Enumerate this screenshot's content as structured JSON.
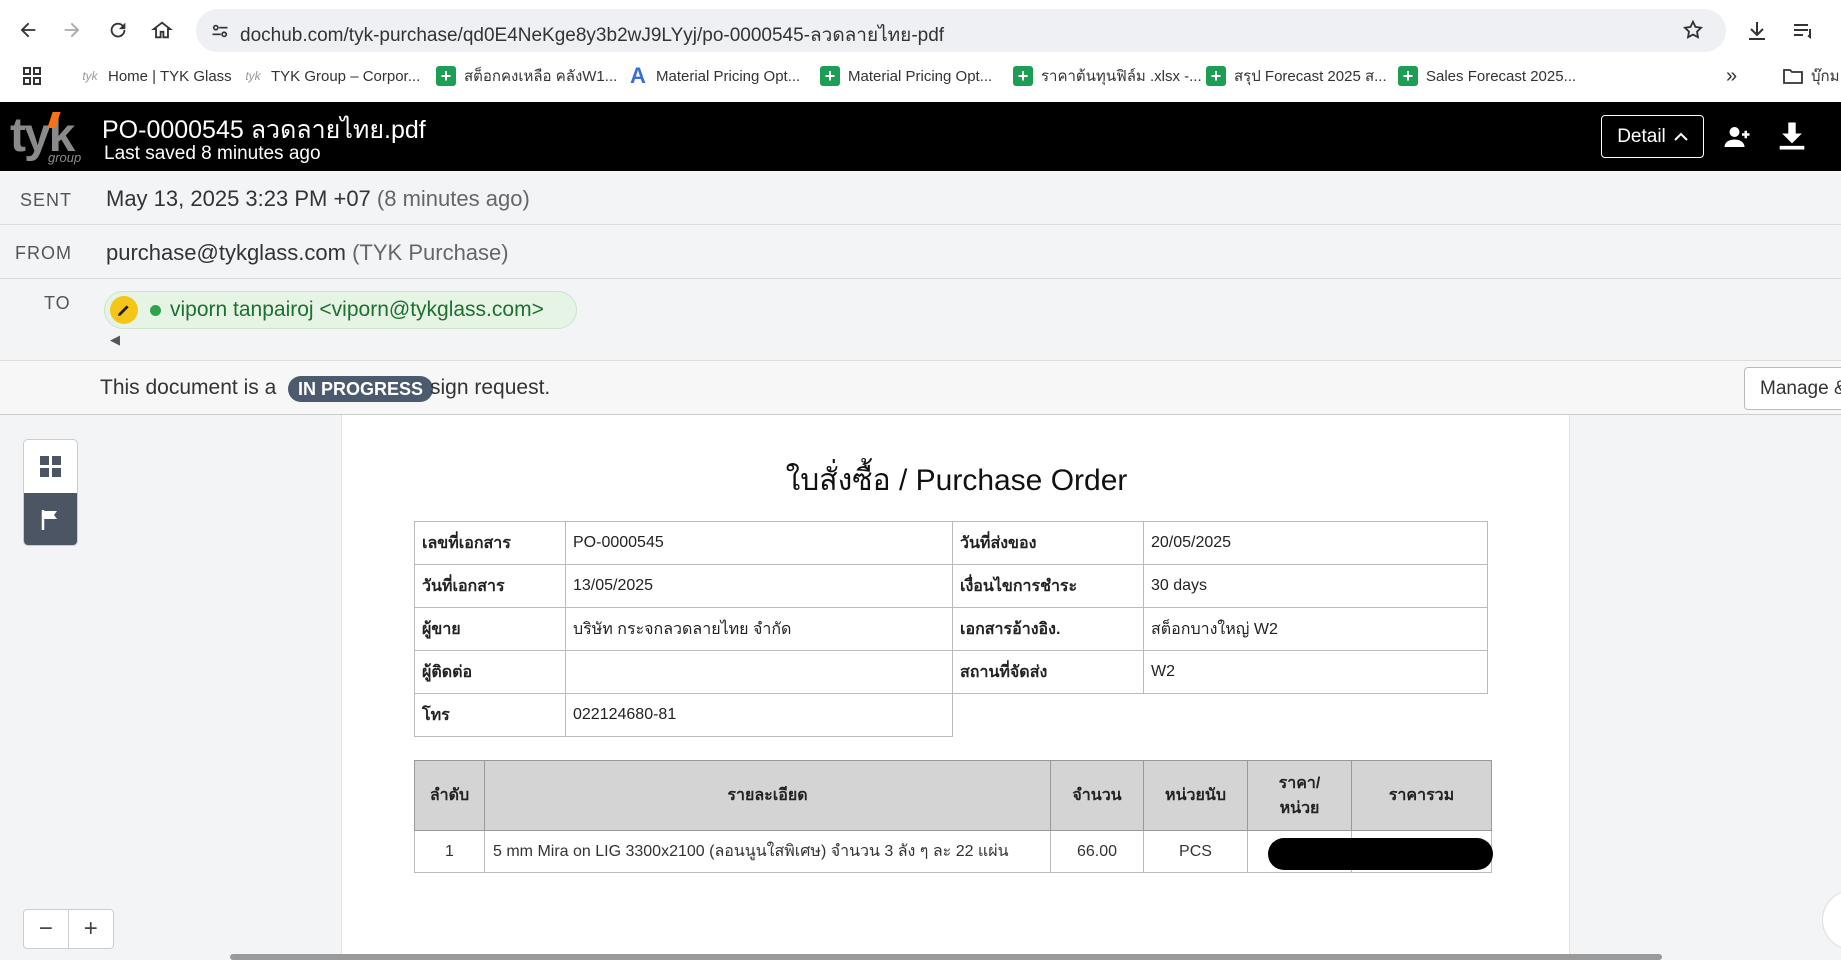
{
  "browser": {
    "url": "dochub.com/tyk-purchase/qd0E4NeKge8y3b2wJ9LYyj/po-0000545-ลวดลายไทย-pdf",
    "bookmarks": [
      {
        "label": "Home | TYK Glass",
        "icon": "tyk-icon"
      },
      {
        "label": "TYK Group – Corpor...",
        "icon": "tyk-icon"
      },
      {
        "label": "สต็อกคงเหลือ คลังW1...",
        "icon": "sheets-icon"
      },
      {
        "label": "Material Pricing Opt...",
        "icon": "font-a-icon"
      },
      {
        "label": "Material Pricing Opt...",
        "icon": "sheets-icon"
      },
      {
        "label": "ราคาต้นทุนฟิล์ม .xlsx -...",
        "icon": "sheets-icon"
      },
      {
        "label": "สรุป Forecast 2025 ส...",
        "icon": "sheets-icon"
      },
      {
        "label": "Sales Forecast 2025...",
        "icon": "sheets-icon"
      }
    ],
    "bookmark_folder": "บุ๊กม",
    "more": "»"
  },
  "header": {
    "logo_main": "tyk",
    "logo_sub": "group",
    "title": "PO-0000545 ลวดลายไทย.pdf",
    "saved": "Last saved 8 minutes ago",
    "detail_label": "Detail",
    "accent": "#f97316"
  },
  "meta": {
    "sent_label": "SENT",
    "sent_value": "May 13, 2025 3:23 PM +07",
    "sent_ago": "(8 minutes ago)",
    "from_label": "FROM",
    "from_email": "purchase@tykglass.com",
    "from_name": "(TYK Purchase)",
    "to_label": "TO",
    "recipient": "viporn tanpairoj <viporn@tykglass.com>"
  },
  "status": {
    "pre": "This document is a",
    "badge": "IN PROGRESS",
    "post": "sign request.",
    "manage": "Manage &"
  },
  "zoom": {
    "out": "−",
    "in": "+"
  },
  "document": {
    "title": "ใบสั่งซื้อ / Purchase Order",
    "info": [
      {
        "k1": "เลขที่เอกสาร",
        "v1": "PO-0000545",
        "k2": "วันที่ส่งของ",
        "v2": "20/05/2025"
      },
      {
        "k1": "วันที่เอกสาร",
        "v1": "13/05/2025",
        "k2": "เงื่อนไขการชำระ",
        "v2": "30 days"
      },
      {
        "k1": "ผู้ขาย",
        "v1": "บริษัท กระจกลวดลายไทย จำกัด",
        "k2": "เอกสารอ้างอิง.",
        "v2": "สต็อกบางใหญ่ W2"
      },
      {
        "k1": "ผู้ติดต่อ",
        "v1": "",
        "k2": "สถานที่จัดส่ง",
        "v2": "W2"
      },
      {
        "k1": "โทร",
        "v1": "022124680-81"
      }
    ],
    "item_headers": {
      "no": "ลำดับ",
      "desc": "รายละเอียด",
      "qty": "จำนวน",
      "unit": "หน่วยนับ",
      "price_line1": "ราคา/",
      "price_line2": "หน่วย",
      "total": "ราคารวม"
    },
    "items": [
      {
        "no": "1",
        "desc": "5 mm Mira on LIG 3300x2100    (ลอนนูนใสพิเศษ) จำนวน 3 ลัง ๆ ละ 22 แผ่น",
        "qty": "66.00",
        "unit": "PCS",
        "price": "",
        "total": ""
      }
    ]
  }
}
